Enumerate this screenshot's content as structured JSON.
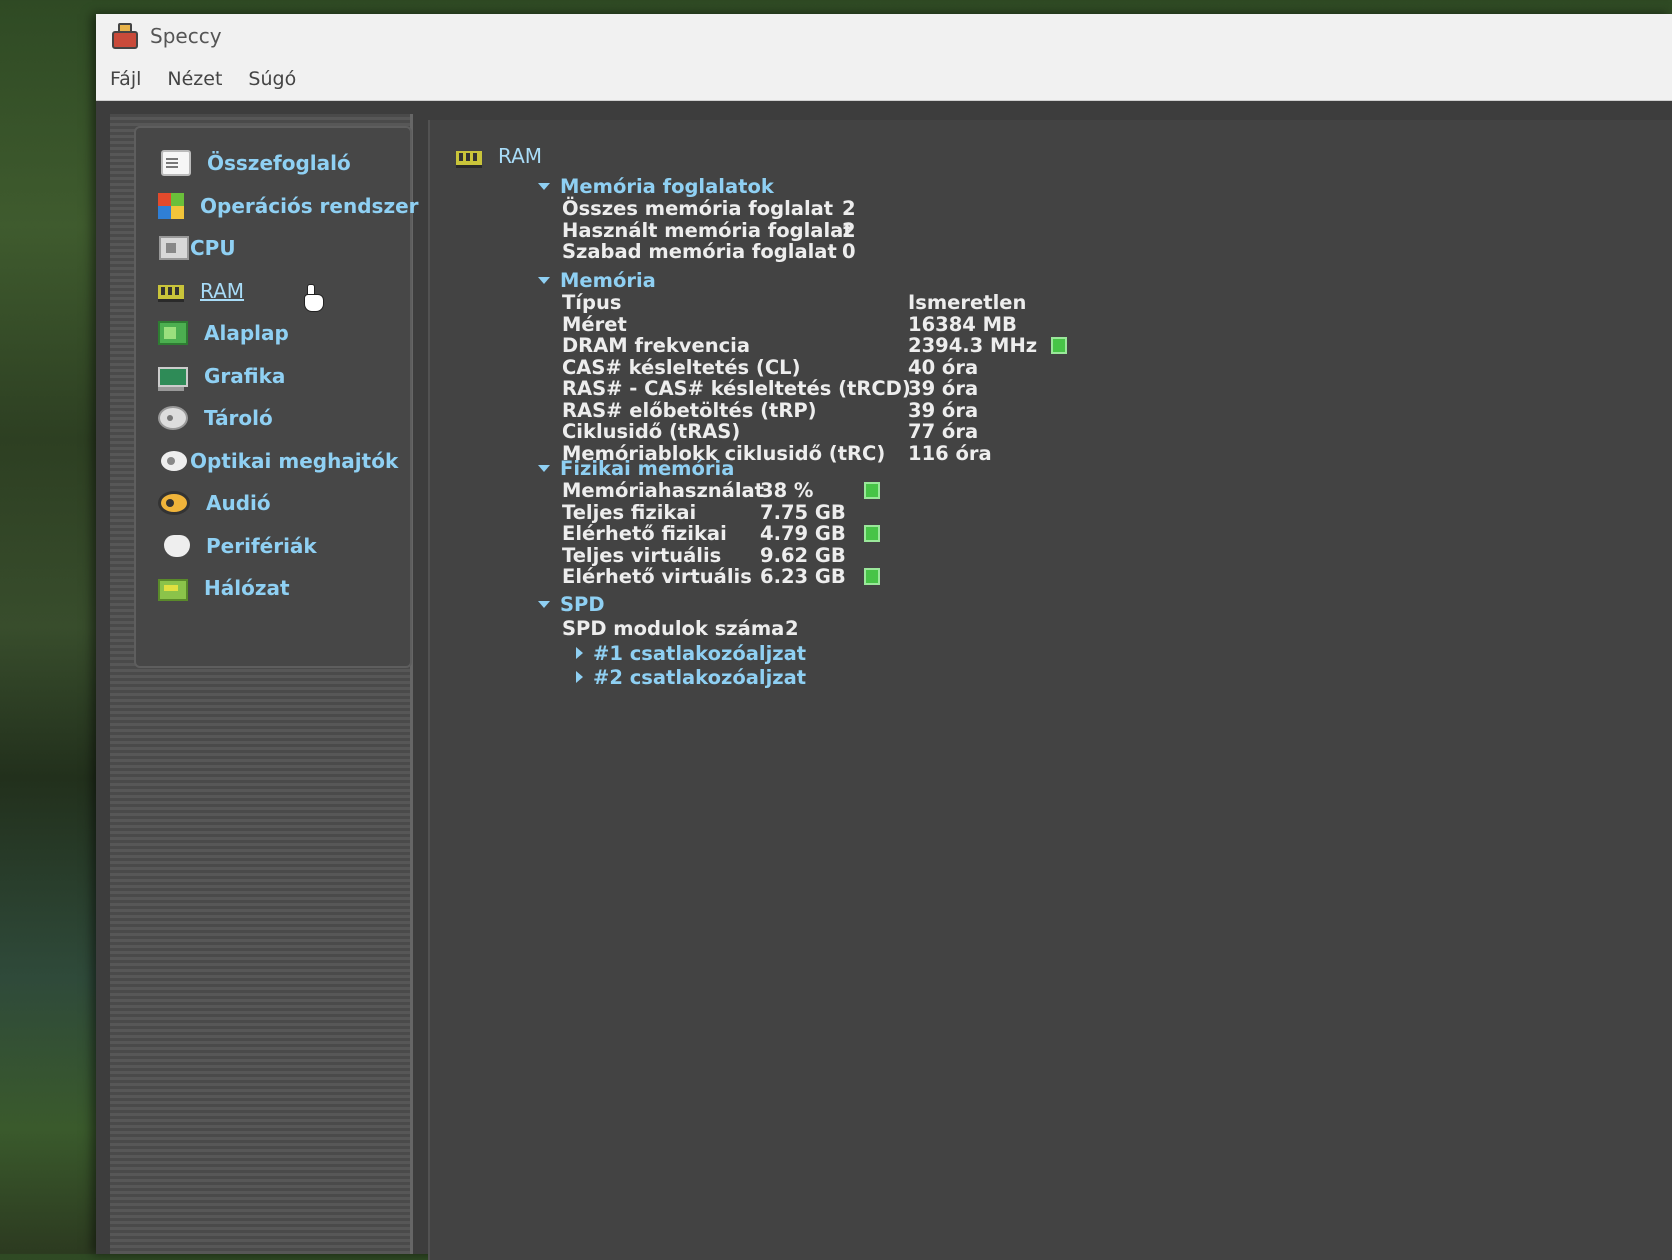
{
  "window": {
    "title": "Speccy"
  },
  "menu": [
    "Fájl",
    "Nézet",
    "Súgó"
  ],
  "sidebar": {
    "items": [
      {
        "label": "Összefoglaló",
        "icon": "summary-icon"
      },
      {
        "label": "Operációs rendszer",
        "icon": "os-icon"
      },
      {
        "label": "CPU",
        "icon": "cpu-icon"
      },
      {
        "label": "RAM",
        "icon": "ram-icon",
        "active": true
      },
      {
        "label": "Alaplap",
        "icon": "motherboard-icon"
      },
      {
        "label": "Grafika",
        "icon": "graphics-icon"
      },
      {
        "label": "Tároló",
        "icon": "storage-icon"
      },
      {
        "label": "Optikai meghajtók",
        "icon": "optical-drive-icon"
      },
      {
        "label": "Audió",
        "icon": "audio-icon"
      },
      {
        "label": "Perifériák",
        "icon": "peripherals-icon"
      },
      {
        "label": "Hálózat",
        "icon": "network-icon"
      }
    ]
  },
  "content": {
    "title": "RAM",
    "slots": {
      "header": "Memória foglalatok",
      "rows": [
        {
          "key": "Összes memória foglalat",
          "value": "2"
        },
        {
          "key": "Használt memória foglalat",
          "value": "2"
        },
        {
          "key": "Szabad memória foglalat",
          "value": "0"
        }
      ]
    },
    "memory": {
      "header": "Memória",
      "rows": [
        {
          "key": "Típus",
          "value": "Ismeretlen"
        },
        {
          "key": "Méret",
          "value": "16384 MB"
        },
        {
          "key": "DRAM frekvencia",
          "value": "2394.3 MHz"
        },
        {
          "key": "CAS# késleltetés (CL)",
          "value": "40 óra"
        },
        {
          "key": "RAS# - CAS# késleltetés (tRCD)",
          "value": "39 óra"
        },
        {
          "key": "RAS# előbetöltés (tRP)",
          "value": "39 óra"
        },
        {
          "key": "Ciklusidő (tRAS)",
          "value": "77 óra"
        },
        {
          "key": "Memóriablokk ciklusidő (tRC)",
          "value": "116 óra"
        }
      ]
    },
    "physical": {
      "header": "Fizikai memória",
      "rows": [
        {
          "key": "Memóriahasználat",
          "value": "38 %"
        },
        {
          "key": "Teljes fizikai",
          "value": "7.75 GB"
        },
        {
          "key": "Elérhető fizikai",
          "value": "4.79 GB"
        },
        {
          "key": "Teljes virtuális",
          "value": "9.62 GB"
        },
        {
          "key": "Elérhető virtuális",
          "value": "6.23 GB"
        }
      ]
    },
    "spd": {
      "header": "SPD",
      "modules_key": "SPD modulok száma",
      "modules_value": "2",
      "children": [
        "#1 csatlakozóaljzat",
        "#2 csatlakozóaljzat"
      ]
    }
  },
  "colors": {
    "link": "#8fd0f3",
    "value_text": "#ededed",
    "indicator_green": "#47c447",
    "panel_bg": "#434343"
  }
}
